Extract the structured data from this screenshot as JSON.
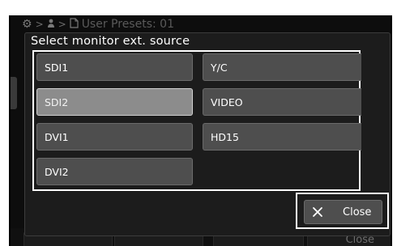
{
  "breadcrumb": {
    "sep1": ">",
    "sep2": ">",
    "preset_label": "User Presets: 01"
  },
  "dialog": {
    "title": "Select monitor ext. source",
    "options": [
      {
        "label": "SDI1",
        "selected": false
      },
      {
        "label": "Y/C",
        "selected": false
      },
      {
        "label": "SDI2",
        "selected": true
      },
      {
        "label": "VIDEO",
        "selected": false
      },
      {
        "label": "DVI1",
        "selected": false
      },
      {
        "label": "HD15",
        "selected": false
      },
      {
        "label": "DVI2",
        "selected": false
      }
    ],
    "close_label": "Close"
  },
  "background": {
    "close_label": "Close"
  },
  "icons": {
    "settings": "gear-icon",
    "user": "person-icon",
    "preset": "document-icon",
    "close": "x-icon"
  }
}
